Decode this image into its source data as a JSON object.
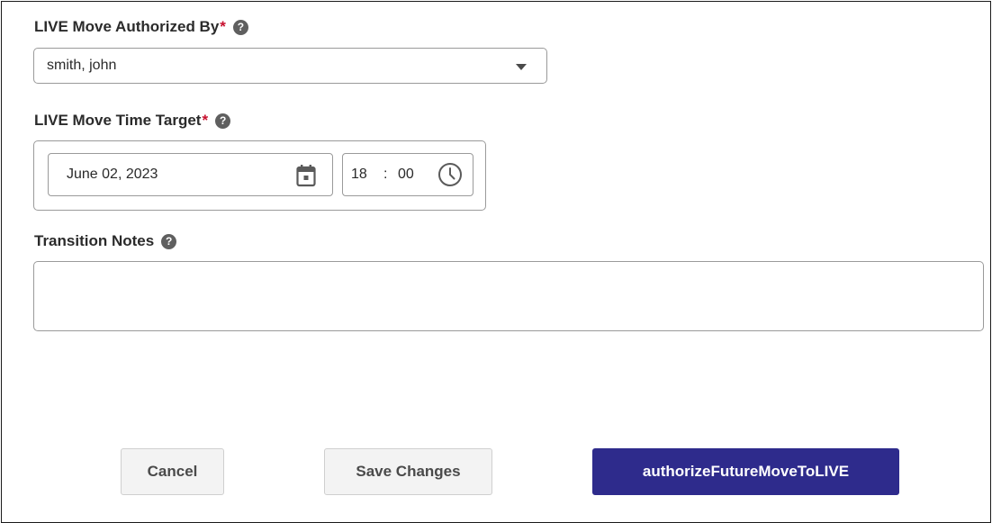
{
  "authorized_by": {
    "label": "LIVE Move Authorized By",
    "required_marker": "*",
    "help_icon": "question-circle-icon",
    "value": "smith, john"
  },
  "time_target": {
    "label": "LIVE Move Time Target",
    "required_marker": "*",
    "help_icon": "question-circle-icon",
    "date": "June 02, 2023",
    "hour": "18",
    "separator": ":",
    "minute": "00"
  },
  "notes": {
    "label": "Transition Notes",
    "help_icon": "question-circle-icon",
    "value": ""
  },
  "buttons": {
    "cancel": "Cancel",
    "save": "Save Changes",
    "authorize": "authorizeFutureMoveToLIVE"
  },
  "colors": {
    "primary": "#2e2b8c",
    "required": "#c8102e",
    "secondary_button_bg": "#f3f3f3"
  }
}
